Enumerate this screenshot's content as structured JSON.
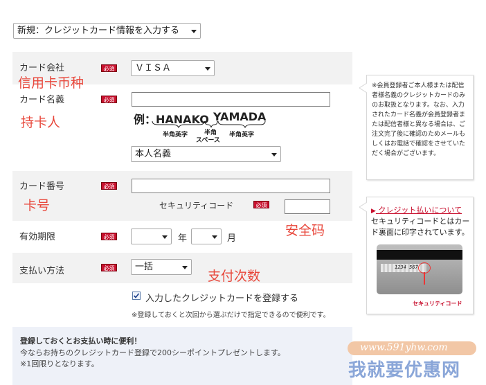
{
  "top_select": "新規：クレジットカード情報を入力する",
  "form": {
    "required_badge": "必須",
    "brand": {
      "label": "カード会社",
      "value": "ＶＩＳＡ",
      "annotation": "信用卡币种"
    },
    "holder": {
      "label": "カード名義",
      "annotation": "持卡人",
      "example_prefix": "例：",
      "example_first": "HANAKO",
      "example_last": "YAMADA",
      "sub_first": "半角英字",
      "sub_space_1": "半角",
      "sub_space_2": "スペース",
      "sub_last": "半角英字",
      "name_type_select": "本人名義"
    },
    "number": {
      "label": "カード番号",
      "annotation": "卡号",
      "security_label": "セキュリティコード",
      "security_annotation": "安全码"
    },
    "expiry": {
      "label": "有効期限",
      "year_unit": "年",
      "month_unit": "月"
    },
    "payment": {
      "label": "支払い方法",
      "value": "一括",
      "annotation": "支付次数"
    },
    "register_checkbox": {
      "checked": true,
      "label": "入力したクレジットカードを登録する"
    },
    "register_note": "※登録しておくと次回から選ぶだけで指定できるので便利です。"
  },
  "side_note": "※会員登録者ご本人様または配信者様名義のクレジットカードのみのお取扱となります。なお、入力されたカード名義が会員登録者または配信者様と異なる場合は、ご注文完了後に確認のためメールもしくはお電話で確認をさせていただく場合がございます。",
  "security_help": {
    "link": "クレジット払いについて",
    "text": "セキュリティコードとはカード裏面に印字されています。",
    "card_number": "1234 567",
    "card_caption": "セキュリティコード"
  },
  "promo": {
    "title": "登録しておくとお支払い時に便利！",
    "line1": "今ならお持ちのクレジットカード登録で200シーポイントプレゼントします。",
    "line2": "※1回限りとなります。"
  },
  "watermark": {
    "url": "www.591yhw.com",
    "text": "我就要优惠网"
  },
  "colors": {
    "required": "#c8102e",
    "annotation": "#e8473b",
    "row_bg": "#f2f2f2",
    "promo_bg": "#eef1f8",
    "link": "#c8102e"
  }
}
